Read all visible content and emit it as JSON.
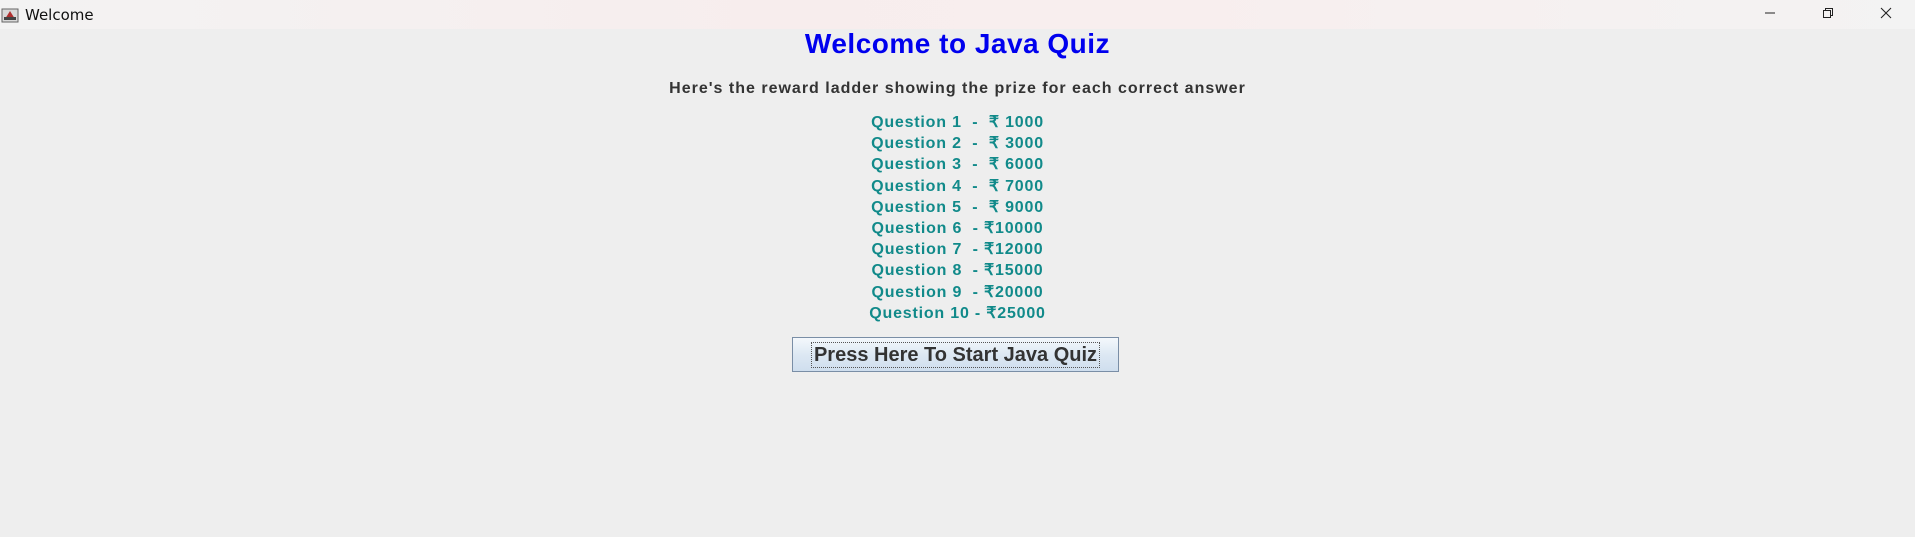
{
  "window": {
    "title": "Welcome",
    "icon": "java-app-icon",
    "controls": [
      "minimize-icon",
      "restore-icon",
      "close-icon"
    ]
  },
  "main": {
    "heading": "Welcome to Java Quiz",
    "subheading": "Here's the reward ladder showing the prize for each correct answer",
    "ladder": [
      "Question 1  -  ₹ 1000",
      "Question 2  -  ₹ 3000",
      "Question 3  -  ₹ 6000",
      "Question 4  -  ₹ 7000",
      "Question 5  -  ₹ 9000",
      "Question 6  - ₹10000",
      "Question 7  - ₹12000",
      "Question 8  - ₹15000",
      "Question 9  - ₹20000",
      "Question 10 - ₹25000"
    ],
    "start_button_label": "Press Here To Start Java Quiz"
  },
  "colors": {
    "heading": "#0000ee",
    "ladder": "#118a8a",
    "background": "#eeeeee"
  }
}
